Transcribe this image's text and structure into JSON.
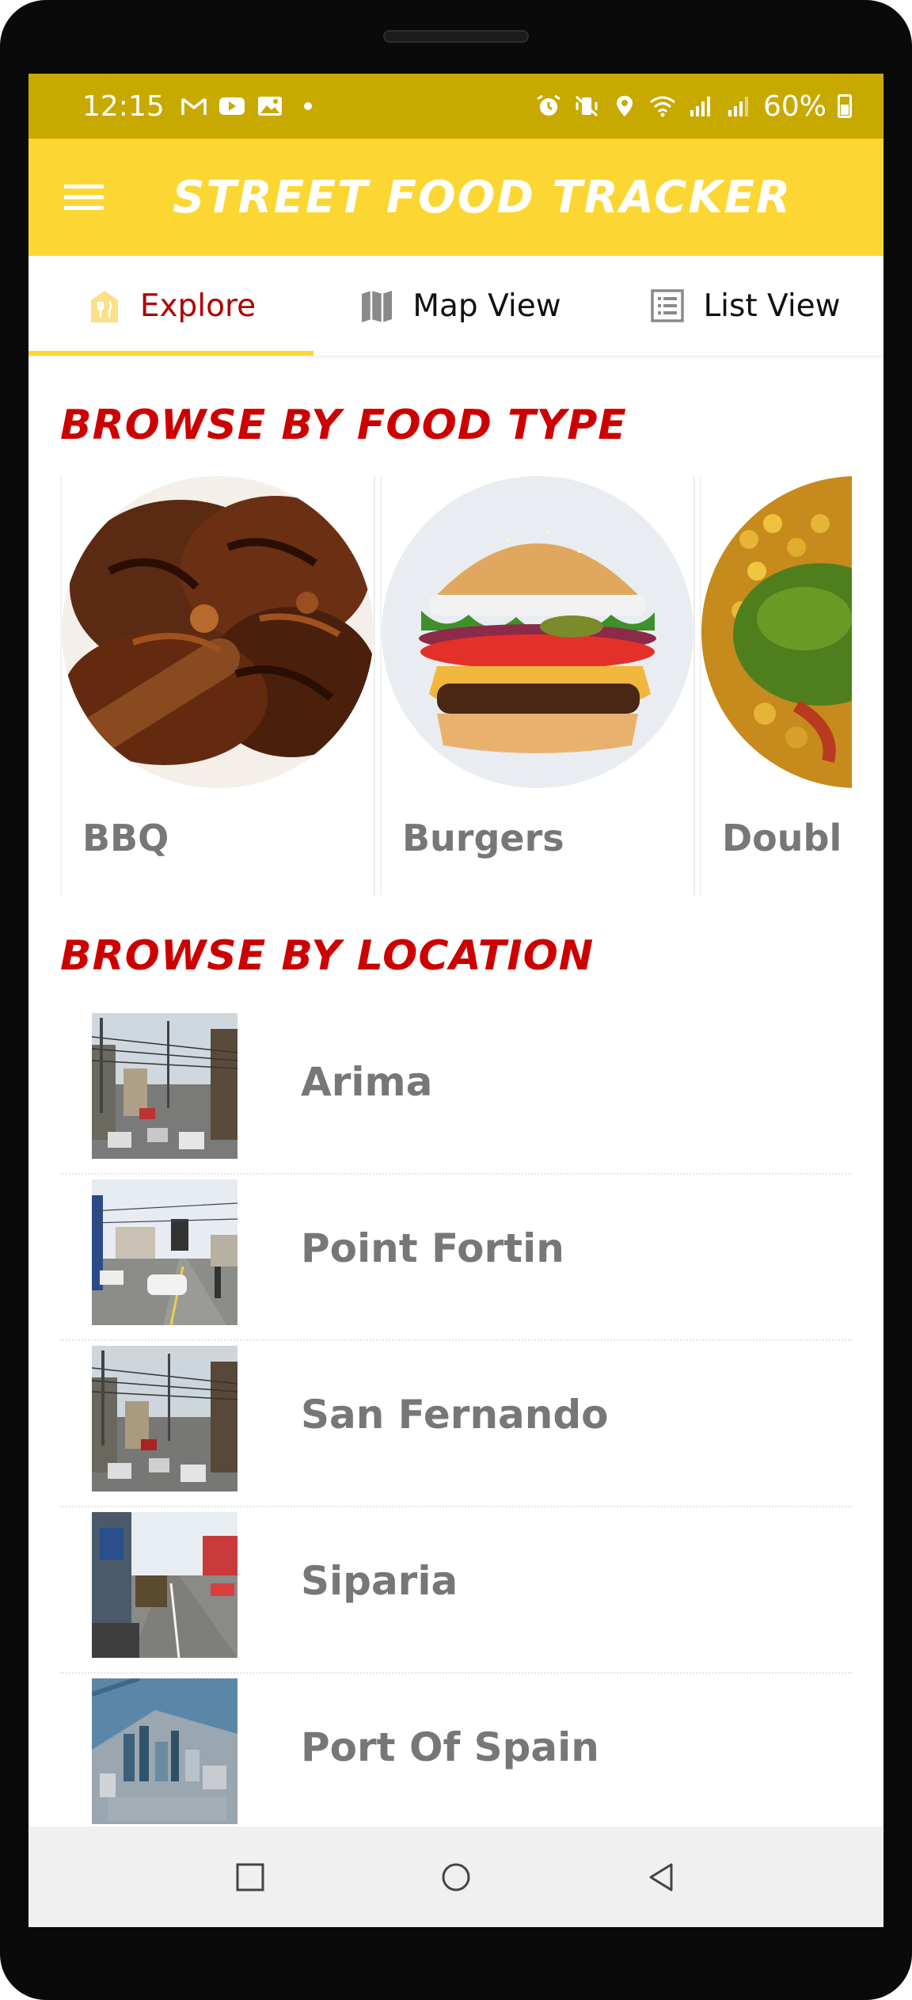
{
  "status_bar": {
    "time": "12:15",
    "battery": "60%",
    "left_icons": [
      "gmail-icon",
      "youtube-icon",
      "gallery-icon",
      "dot-icon"
    ],
    "right_icons": [
      "alarm-icon",
      "vibrate-mute-icon",
      "location-icon",
      "wifi-icon",
      "signal-icon",
      "signal-icon-2",
      "battery-icon"
    ]
  },
  "app_bar": {
    "title": "Street Food Tracker",
    "menu_icon": "hamburger-menu-icon"
  },
  "tabs": [
    {
      "label": "Explore",
      "icon": "restaurant-icon",
      "active": true
    },
    {
      "label": "Map View",
      "icon": "map-icon",
      "active": false
    },
    {
      "label": "List View",
      "icon": "list-icon",
      "active": false
    }
  ],
  "food_section": {
    "heading": "Browse by food type",
    "items": [
      {
        "label": "BBQ",
        "image": "grilled-chicken-image"
      },
      {
        "label": "Burgers",
        "image": "cheeseburger-image"
      },
      {
        "label": "Doubl",
        "image": "doubles-image"
      }
    ]
  },
  "location_section": {
    "heading": "Browse by location",
    "items": [
      {
        "name": "Arima",
        "image": "arima-street-photo"
      },
      {
        "name": "Point Fortin",
        "image": "point-fortin-street-photo"
      },
      {
        "name": "San Fernando",
        "image": "san-fernando-street-photo"
      },
      {
        "name": "Siparia",
        "image": "siparia-street-photo"
      },
      {
        "name": "Port Of Spain",
        "image": "port-of-spain-aerial-photo"
      }
    ]
  },
  "nav_bar": {
    "buttons": [
      "recent-apps-icon",
      "home-icon",
      "back-icon"
    ]
  },
  "colors": {
    "status_bar": "#c8a900",
    "app_bar": "#fcd733",
    "accent_red": "#cc0000",
    "tab_active_text": "#b00000",
    "muted_text": "#777777"
  }
}
